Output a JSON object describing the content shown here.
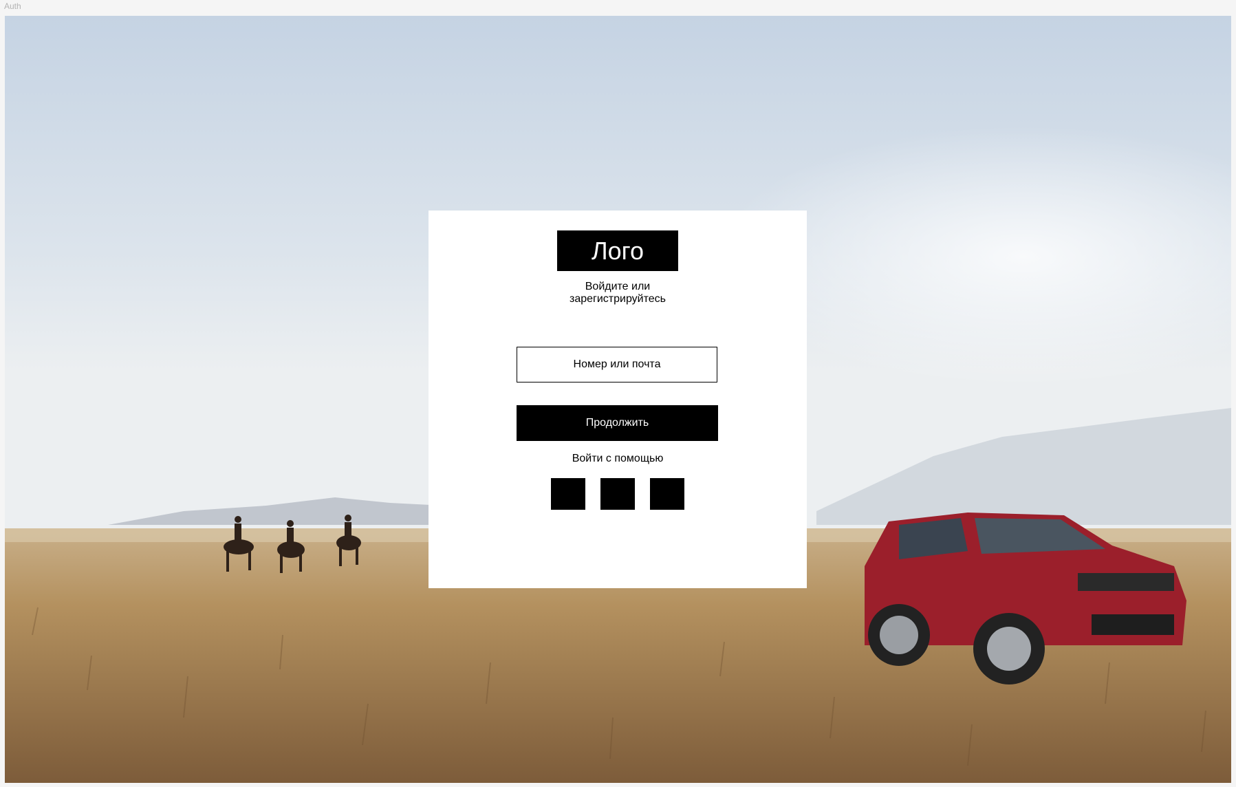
{
  "frame": {
    "label": "Auth"
  },
  "auth": {
    "logo": "Лого",
    "subtitle_line1": "Войдите или",
    "subtitle_line2": "зарегистрируйтесь",
    "input_placeholder": "Номер или почта",
    "continue_label": "Продолжить",
    "social_label": "Войти с помощью",
    "social_buttons_count": 3
  },
  "colors": {
    "card": "#ffffff",
    "accent": "#000000",
    "car": "#9b1f2b"
  }
}
